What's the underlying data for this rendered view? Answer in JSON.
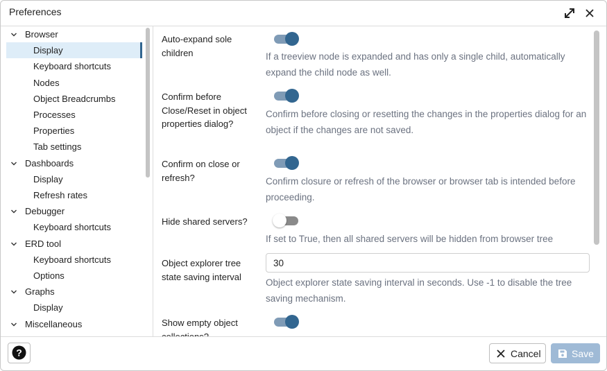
{
  "window": {
    "title": "Preferences",
    "expand_icon": "expand-icon",
    "close_icon": "close-icon"
  },
  "tree": [
    {
      "label": "Browser",
      "type": "group"
    },
    {
      "label": "Display",
      "type": "child",
      "selected": true
    },
    {
      "label": "Keyboard shortcuts",
      "type": "child"
    },
    {
      "label": "Nodes",
      "type": "child"
    },
    {
      "label": "Object Breadcrumbs",
      "type": "child"
    },
    {
      "label": "Processes",
      "type": "child"
    },
    {
      "label": "Properties",
      "type": "child"
    },
    {
      "label": "Tab settings",
      "type": "child"
    },
    {
      "label": "Dashboards",
      "type": "group"
    },
    {
      "label": "Display",
      "type": "child"
    },
    {
      "label": "Refresh rates",
      "type": "child"
    },
    {
      "label": "Debugger",
      "type": "group"
    },
    {
      "label": "Keyboard shortcuts",
      "type": "child"
    },
    {
      "label": "ERD tool",
      "type": "group"
    },
    {
      "label": "Keyboard shortcuts",
      "type": "child"
    },
    {
      "label": "Options",
      "type": "child"
    },
    {
      "label": "Graphs",
      "type": "group"
    },
    {
      "label": "Display",
      "type": "child"
    },
    {
      "label": "Miscellaneous",
      "type": "group"
    }
  ],
  "settings": {
    "auto_expand": {
      "label": "Auto-expand sole children",
      "enabled": true,
      "help": "If a treeview node is expanded and has only a single child, automatically expand the child node as well."
    },
    "confirm_close_reset": {
      "label": "Confirm before Close/Reset in object properties dialog?",
      "enabled": true,
      "help": "Confirm before closing or resetting the changes in the properties dialog for an object if the changes are not saved."
    },
    "confirm_refresh": {
      "label": "Confirm on close or refresh?",
      "enabled": true,
      "help": "Confirm closure or refresh of the browser or browser tab is intended before proceeding."
    },
    "hide_shared_servers": {
      "label": "Hide shared servers?",
      "enabled": false,
      "help": "If set to True, then all shared servers will be hidden from browser tree"
    },
    "tree_state_interval": {
      "label": "Object explorer tree state saving interval",
      "value": "30",
      "help": "Object explorer state saving interval in seconds. Use -1 to disable the tree saving mechanism."
    },
    "show_empty_collections": {
      "label": "Show empty object collections?",
      "enabled": true
    }
  },
  "footer": {
    "help_icon": "question-circle-icon",
    "cancel_label": "Cancel",
    "save_label": "Save"
  },
  "colors": {
    "accent": "#326690",
    "selected_bg": "#deedf8",
    "save_disabled": "#9fbad6",
    "help_text": "#6b7280"
  }
}
